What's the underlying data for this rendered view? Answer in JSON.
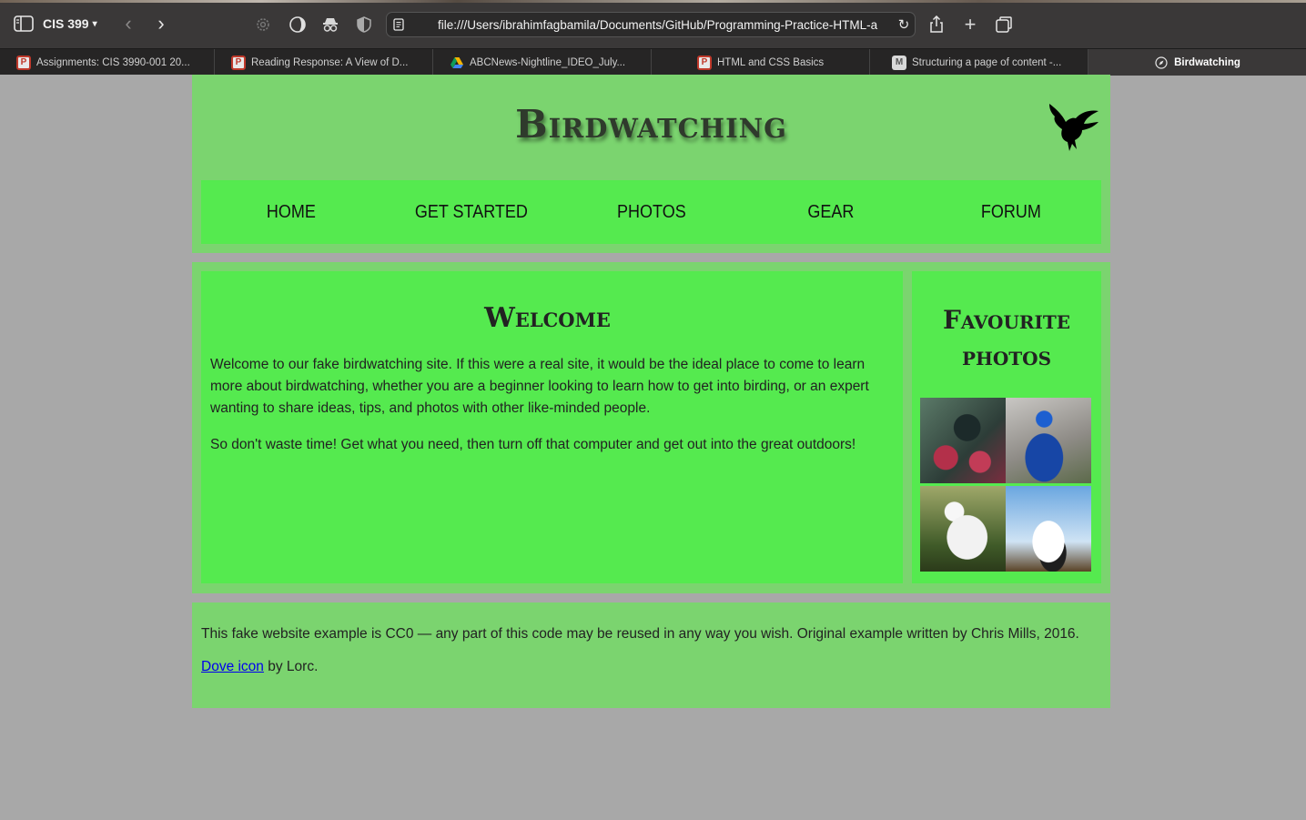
{
  "browser": {
    "tab_group": "CIS 399",
    "url": "file:///Users/ibrahimfagbamila/Documents/GitHub/Programming-Practice-HTML-a",
    "tabs": [
      {
        "title": "Assignments: CIS 3990-001 20...",
        "icon": "p-icon"
      },
      {
        "title": "Reading Response: A View of D...",
        "icon": "p-icon"
      },
      {
        "title": "ABCNews-Nightline_IDEO_July...",
        "icon": "drive-icon"
      },
      {
        "title": "HTML and CSS Basics",
        "icon": "p-icon"
      },
      {
        "title": "Structuring a page of content -...",
        "icon": "m-icon"
      },
      {
        "title": "Birdwatching",
        "icon": "compass-icon",
        "active": true
      }
    ]
  },
  "site": {
    "title": "Birdwatching",
    "logo_icon": "dove-icon",
    "nav": [
      "HOME",
      "GET STARTED",
      "PHOTOS",
      "GEAR",
      "FORUM"
    ],
    "welcome": {
      "heading": "Welcome",
      "paragraphs": [
        "Welcome to our fake birdwatching site. If this were a real site, it would be the ideal place to come to learn more about birdwatching, whether you are a beginner looking to learn how to get into birding, or an expert wanting to share ideas, tips, and photos with other like-minded people.",
        "So don't waste time! Get what you need, then turn off that computer and get out into the great outdoors!"
      ]
    },
    "aside": {
      "heading": "Favourite photos",
      "photos": [
        "tui",
        "peacock",
        "ibis",
        "stork"
      ]
    },
    "footer": {
      "line1": "This fake website example is CC0 — any part of this code may be reused in any way you wish. Original example written by Chris Mills, 2016.",
      "link_text": "Dove icon",
      "line2_suffix": " by Lorc."
    },
    "colors": {
      "outer_green": "#7bd46f",
      "inner_green": "#55ea4f",
      "background": "#a8a8a8"
    }
  }
}
